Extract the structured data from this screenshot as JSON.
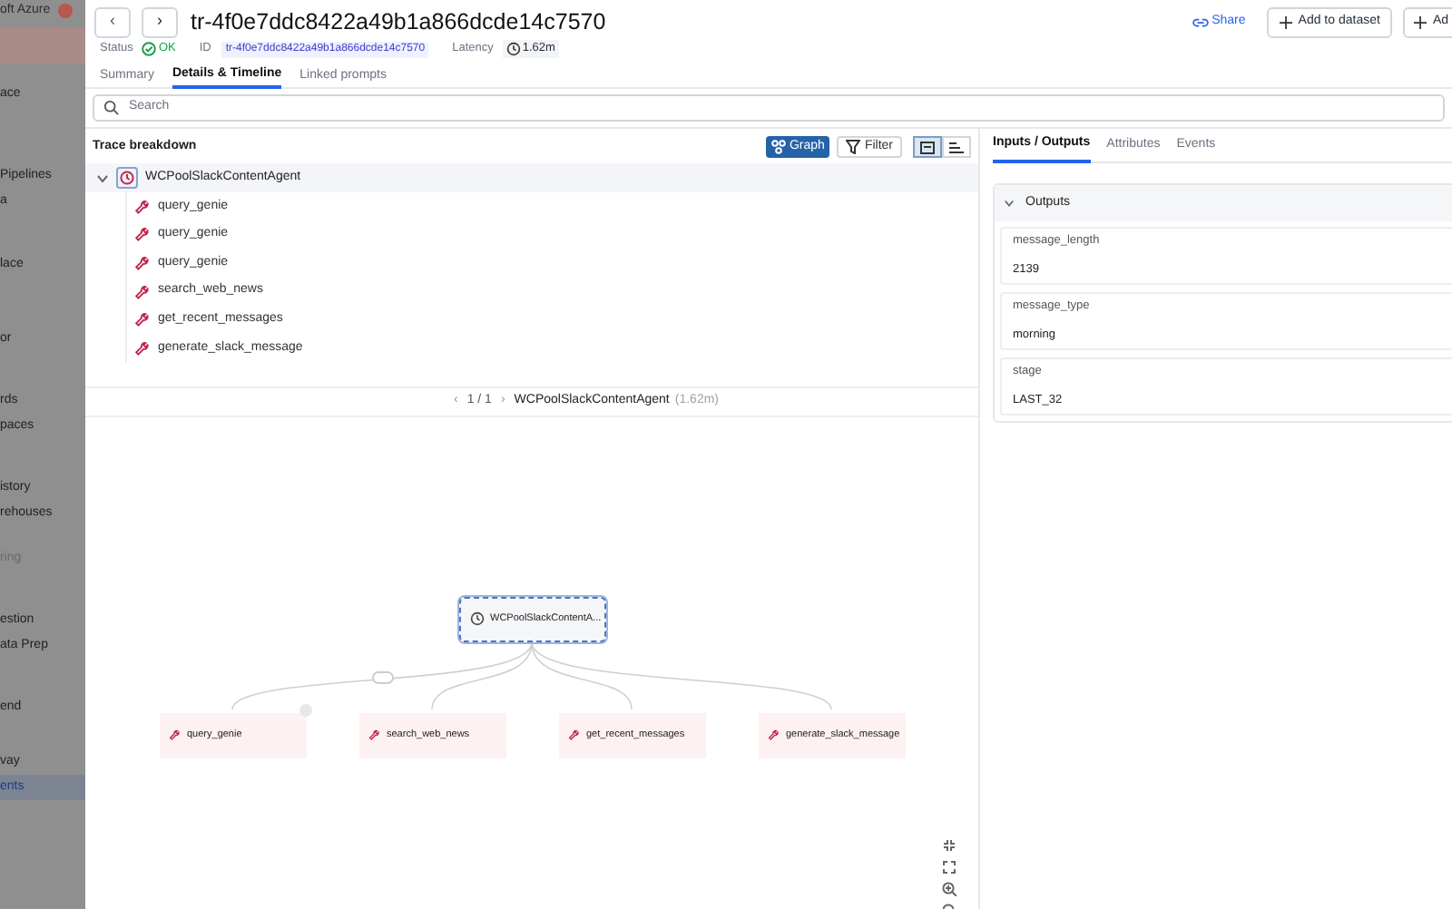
{
  "sidebar": {
    "brand": "oft Azure",
    "groups": [
      [
        {
          "label": "ace",
          "selected": false,
          "disabled": false
        }
      ],
      [
        {
          "label": "Pipelines",
          "selected": false,
          "disabled": false
        },
        {
          "label": "a",
          "selected": false,
          "disabled": false
        }
      ],
      [
        {
          "label": "lace",
          "selected": false,
          "disabled": false
        }
      ],
      [
        {
          "label": "or",
          "selected": false,
          "disabled": false
        }
      ],
      [
        {
          "label": "rds",
          "selected": false,
          "disabled": false
        },
        {
          "label": "paces",
          "selected": false,
          "disabled": false
        }
      ],
      [
        {
          "label": "istory",
          "selected": false,
          "disabled": false
        },
        {
          "label": "rehouses",
          "selected": false,
          "disabled": false
        }
      ],
      [
        {
          "label": "ring",
          "selected": false,
          "disabled": true
        }
      ],
      [
        {
          "label": "estion",
          "selected": false,
          "disabled": false
        },
        {
          "label": "ata Prep",
          "selected": false,
          "disabled": false
        }
      ],
      [
        {
          "label": "end",
          "selected": false,
          "disabled": false
        }
      ],
      [
        {
          "label": "vay",
          "selected": false,
          "disabled": false
        },
        {
          "label": "ents",
          "selected": true,
          "disabled": false
        }
      ]
    ]
  },
  "header": {
    "back": "‹",
    "forward": "›",
    "title": "tr-4f0e7ddc8422a49b1a866dcde14c7570",
    "share": "Share",
    "add_to_dataset": "Add to dataset",
    "add_cut": "Ad",
    "status_label": "Status",
    "status": "OK",
    "id_label": "ID",
    "id": "tr-4f0e7ddc8422a49b1a866dcde14c7570",
    "latency_label": "Latency",
    "latency": "1.62m"
  },
  "tabs": [
    {
      "label": "Summary",
      "selected": false
    },
    {
      "label": "Details & Timeline",
      "selected": true
    },
    {
      "label": "Linked prompts",
      "selected": false
    }
  ],
  "search": {
    "placeholder": "Search"
  },
  "trace_breakdown": {
    "title": "Trace breakdown",
    "graph_button": {
      "label": "Graph",
      "selected": true
    },
    "filter": "Filter",
    "views": [
      {
        "kind": "detail",
        "selected": true
      },
      {
        "kind": "timeline",
        "selected": false
      }
    ],
    "tree": {
      "label": "WCPoolSlackContentAgent",
      "kind": "agent",
      "expanded": true,
      "children": [
        {
          "label": "query_genie",
          "kind": "tool"
        },
        {
          "label": "query_genie",
          "kind": "tool"
        },
        {
          "label": "query_genie",
          "kind": "tool"
        },
        {
          "label": "search_web_news",
          "kind": "tool"
        },
        {
          "label": "get_recent_messages",
          "kind": "tool"
        },
        {
          "label": "generate_slack_message",
          "kind": "tool"
        }
      ]
    },
    "pager": {
      "prev": "‹",
      "page": "1 / 1",
      "next": "›",
      "name": "WCPoolSlackContentAgent",
      "duration": "(1.62m)"
    }
  },
  "graph": {
    "root": {
      "label": "WCPoolSlackContentA...",
      "selected": true
    },
    "children": [
      {
        "label": "query_genie"
      },
      {
        "label": "search_web_news"
      },
      {
        "label": "get_recent_messages"
      },
      {
        "label": "generate_slack_message"
      }
    ]
  },
  "details": {
    "tabs": [
      {
        "label": "Inputs / Outputs",
        "selected": true
      },
      {
        "label": "Attributes",
        "selected": false
      },
      {
        "label": "Events",
        "selected": false
      }
    ],
    "section": {
      "title": "Outputs",
      "expanded": true,
      "fields": [
        {
          "key": "message_length",
          "value": "2139"
        },
        {
          "key": "message_type",
          "value": "morning"
        },
        {
          "key": "stage",
          "value": "LAST_32"
        }
      ]
    }
  }
}
